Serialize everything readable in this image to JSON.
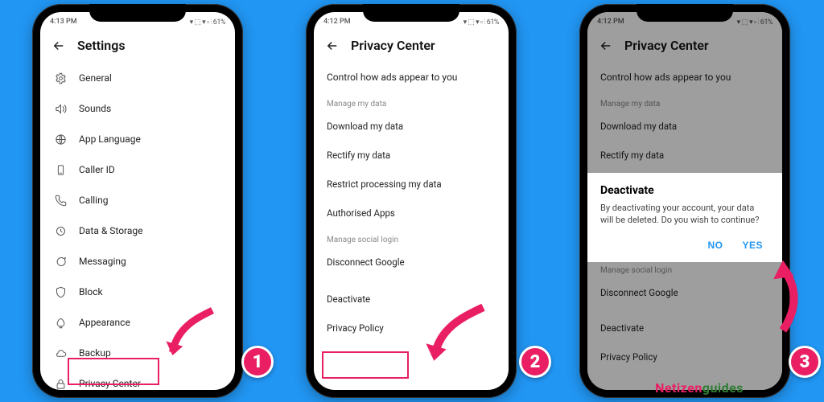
{
  "status": {
    "time1": "4:13 PM",
    "time2": "4:12 PM",
    "time3": "4:12 PM",
    "right": "▾ ⬚ ▾ ▫ ⫶ 61%"
  },
  "screen1": {
    "title": "Settings",
    "items": [
      {
        "icon": "gear",
        "label": "General"
      },
      {
        "icon": "sound",
        "label": "Sounds"
      },
      {
        "icon": "globe",
        "label": "App Language"
      },
      {
        "icon": "phone-id",
        "label": "Caller ID"
      },
      {
        "icon": "phone",
        "label": "Calling"
      },
      {
        "icon": "time",
        "label": "Data & Storage"
      },
      {
        "icon": "chat",
        "label": "Messaging"
      },
      {
        "icon": "shield",
        "label": "Block"
      },
      {
        "icon": "brush",
        "label": "Appearance"
      },
      {
        "icon": "cloud",
        "label": "Backup"
      },
      {
        "icon": "lock",
        "label": "Privacy Center"
      }
    ]
  },
  "screen2": {
    "title": "Privacy Center",
    "ads_row": "Control how ads appear to you",
    "section1": "Manage my data",
    "items1": [
      "Download my data",
      "Rectify my data",
      "Restrict processing my data",
      "Authorised Apps"
    ],
    "section2": "Manage social login",
    "items2": [
      "Disconnect Google"
    ],
    "items3": [
      "Deactivate",
      "Privacy Policy"
    ]
  },
  "screen3": {
    "title": "Privacy Center",
    "ads_row": "Control how ads appear to you",
    "section1": "Manage my data",
    "items1": [
      "Download my data",
      "Rectify my data"
    ],
    "dialog": {
      "title": "Deactivate",
      "body": "By deactivating your account, your data will be deleted. Do you wish to continue?",
      "no": "NO",
      "yes": "YES"
    },
    "section2": "Manage social login",
    "items2": [
      "Disconnect Google"
    ],
    "items3": [
      "Deactivate",
      "Privacy Policy"
    ]
  },
  "steps": {
    "s1": "1",
    "s2": "2",
    "s3": "3"
  },
  "watermark": {
    "a": "Netizen",
    "b": "guides"
  }
}
